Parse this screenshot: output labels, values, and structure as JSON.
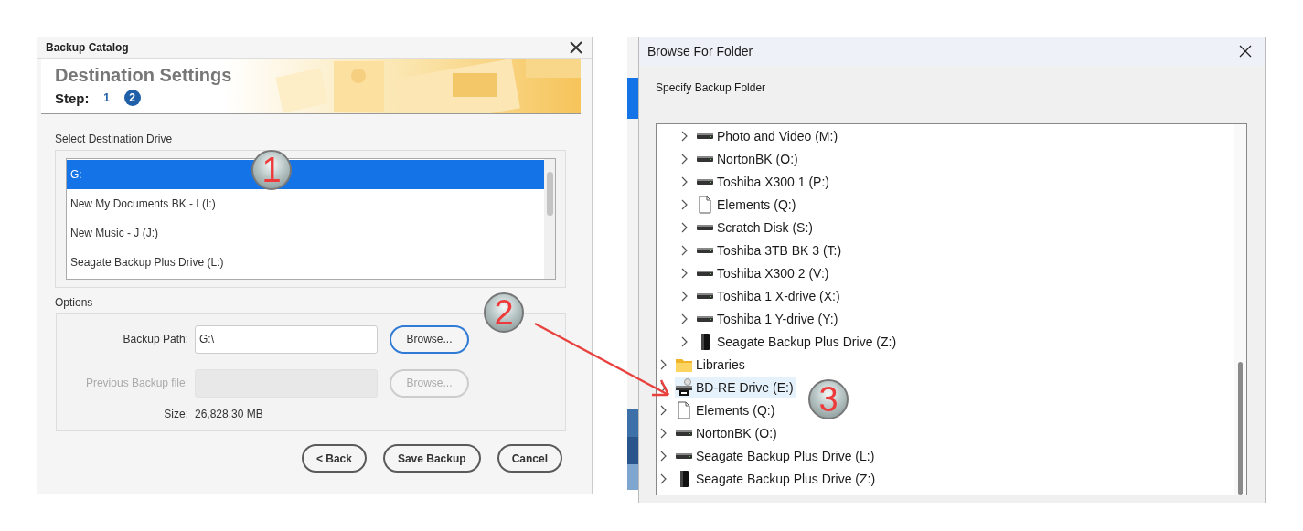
{
  "backup_dialog": {
    "title": "Backup Catalog",
    "heading": "Destination Settings",
    "step_label": "Step:",
    "steps": [
      {
        "label": "1",
        "selected": false
      },
      {
        "label": "2",
        "selected": true
      }
    ],
    "drive_label": "Select Destination Drive",
    "drives": [
      {
        "label": "G:",
        "selected": true
      },
      {
        "label": "New My Documents BK - I (I:)",
        "selected": false
      },
      {
        "label": "New Music - J (J:)",
        "selected": false
      },
      {
        "label": "Seagate Backup Plus Drive (L:)",
        "selected": false
      }
    ],
    "options_label": "Options",
    "fields": [
      {
        "label": "Backup Path:",
        "value": "G:\\",
        "button": "Browse...",
        "disabled": false
      },
      {
        "label": "Previous Backup file:",
        "button": "Browse...",
        "disabled": true
      }
    ],
    "size_label": "Size:",
    "size_value": "26,828.30 MB",
    "buttons": [
      "< Back",
      "Save Backup",
      "Cancel"
    ]
  },
  "folder_dialog": {
    "title": "Browse For Folder",
    "prompt": "Specify Backup Folder",
    "tree": [
      {
        "children": [
          {
            "label": "Photo and Video (M:)",
            "kind": "drive",
            "selected": false
          },
          {
            "label": "NortonBK (O:)",
            "kind": "drive",
            "selected": false
          },
          {
            "label": "Toshiba X300 1 (P:)",
            "kind": "drive",
            "selected": false
          },
          {
            "label": "Elements (Q:)",
            "kind": "file",
            "selected": false
          },
          {
            "label": "Scratch Disk (S:)",
            "kind": "drive",
            "selected": false
          },
          {
            "label": "Toshiba 3TB BK 3 (T:)",
            "kind": "drive",
            "selected": false
          },
          {
            "label": "Toshiba X300 2 (V:)",
            "kind": "drive",
            "selected": false
          },
          {
            "label": "Toshiba 1 X-drive (X:)",
            "kind": "drive",
            "selected": false
          },
          {
            "label": "Toshiba 1 Y-drive (Y:)",
            "kind": "drive",
            "selected": false
          },
          {
            "label": "Seagate Backup Plus Drive (Z:)",
            "kind": "external",
            "selected": false
          }
        ]
      },
      {
        "label": "Libraries",
        "kind": "folder",
        "selected": false
      },
      {
        "label": "BD-RE Drive (E:)",
        "kind": "optical",
        "selected": true
      },
      {
        "label": "Elements (Q:)",
        "kind": "file",
        "selected": false
      },
      {
        "label": "NortonBK (O:)",
        "kind": "drive",
        "selected": false
      },
      {
        "label": "Seagate Backup Plus Drive (L:)",
        "kind": "drive",
        "selected": false
      },
      {
        "label": "Seagate Backup Plus Drive (Z:)",
        "kind": "external",
        "selected": false
      }
    ]
  },
  "annotations": [
    {
      "label": "1"
    },
    {
      "label": "2"
    },
    {
      "label": "3"
    }
  ]
}
